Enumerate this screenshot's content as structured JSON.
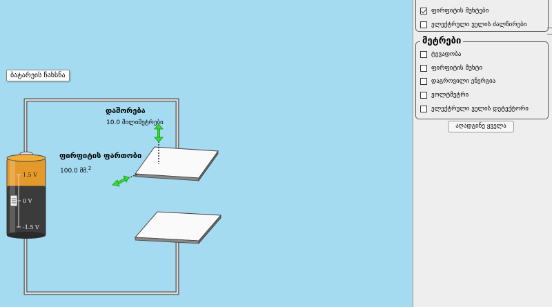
{
  "sim": {
    "battery_reset_label": "ბატარეის ჩახსნა",
    "separation": {
      "title": "დაშორება",
      "value": "10.0 მილიმეტრები"
    },
    "plate_area": {
      "title": "ფირფიტის ფართობი",
      "value": "100.0 მმ.",
      "unit_sup": "2"
    },
    "battery": {
      "top_label": "1.5 V",
      "mid_label": "0 V",
      "bottom_label": "-1.5 V"
    }
  },
  "panel": {
    "view": {
      "items": [
        {
          "label": "ფირფიტის მუხტები",
          "checked": true
        },
        {
          "label": "ელექტრული ველის ძალწირები",
          "checked": false
        }
      ]
    },
    "meters": {
      "title": "მეტრები",
      "items": [
        {
          "label": "ტევადობა",
          "checked": false
        },
        {
          "label": "ფირფიტის მუხტი",
          "checked": false
        },
        {
          "label": "დაგროვილი ენერგია",
          "checked": false
        },
        {
          "label": "ვოლტმეტრი",
          "checked": false
        },
        {
          "label": "ელექტრული ველის დეტექტორი",
          "checked": false
        }
      ]
    },
    "reset_all_label": "აღადგინე ყველა"
  },
  "colors": {
    "background": "#a5dbf1",
    "panel": "#eeeeee",
    "arrow": "#33dd33"
  }
}
